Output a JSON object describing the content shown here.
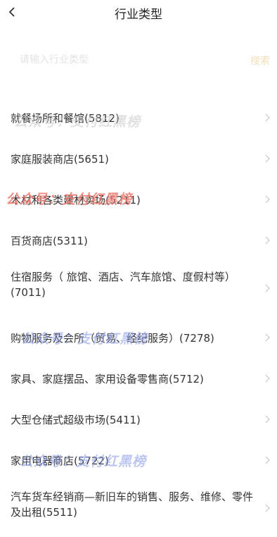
{
  "header": {
    "title": "行业类型"
  },
  "search": {
    "placeholder": "请输入行业类型",
    "button_label": "搜索"
  },
  "items": [
    {
      "label": "就餐场所和餐馆(5812)"
    },
    {
      "label": "家庭服装商店(5651)"
    },
    {
      "label": "木材和各类建材卖场(5211)"
    },
    {
      "label": "百货商店(5311)"
    },
    {
      "label": "住宿服务（ 旅馆、酒店、汽车旅馆、度假村等）(7011)"
    },
    {
      "label": "购物服务及会所（贸易、经纪服务）(7278)"
    },
    {
      "label": "家具、家庭摆品、家用设备零售商(5712)"
    },
    {
      "label": "大型仓储式超级市场(5411)"
    },
    {
      "label": "家用电器商店(5722)"
    },
    {
      "label": "汽车货车经销商—新旧车的销售、服务、维修、零件及出租(5511)"
    }
  ],
  "watermarks": [
    {
      "text": "公众号：支付红黑榜",
      "color": "#c8c8c8"
    },
    {
      "text": "公众号：支付红黑榜",
      "color": "#ee7a70"
    },
    {
      "text": "公众号：支付红黑榜",
      "color": "#8fa0e8"
    },
    {
      "text": "公众号：支付红黑榜",
      "color": "#8fa0e8"
    }
  ],
  "colors": {
    "accent": "#f1dfb8",
    "chevron": "#cccccc"
  },
  "icons": {
    "back": "chevron-left-icon",
    "row": "chevron-right-icon"
  }
}
